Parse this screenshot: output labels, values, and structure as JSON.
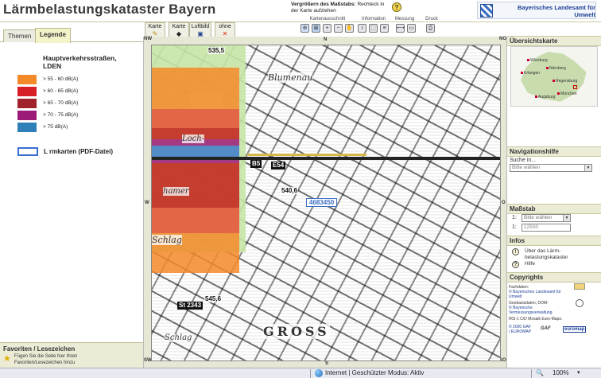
{
  "header": {
    "title": "Lärmbelastungskataster Bayern",
    "hint_bold": "Vergrößern des Maßstabs:",
    "hint_text": "Rechteck in der Karte aufziehen",
    "agency_line1": "Bayerisches Landesamt für",
    "agency_line2": "Umwelt"
  },
  "toolbar": {
    "tabs": [
      {
        "label": "Karte",
        "icon": "pencil-icon"
      },
      {
        "label": "Karte",
        "icon": "bucket-icon"
      },
      {
        "label": "Luftbild",
        "icon": "camera-icon"
      },
      {
        "label": "ohne",
        "icon": "close-icon"
      }
    ],
    "group_labels": [
      "Kartenausschnitt",
      "Information",
      "Messung",
      "Druck"
    ]
  },
  "left": {
    "tabs": [
      "Themen",
      "Legende"
    ],
    "active_tab": "Legende",
    "legend_title_1": "Hauptverkehrsstraßen,",
    "legend_title_2": "LDEN",
    "legend_items": [
      {
        "label": "> 55 - 60 dB(A)",
        "color": "#f4892a"
      },
      {
        "label": "> 60 - 65 dB(A)",
        "color": "#d61f26"
      },
      {
        "label": "> 65 - 70 dB(A)",
        "color": "#a0232c"
      },
      {
        "label": "> 70 - 75 dB(A)",
        "color": "#9c1a78"
      },
      {
        "label": "> 75 dB(A)",
        "color": "#2f7fb8"
      }
    ],
    "pdf_label": "L rmkarten (PDF-Datei)",
    "favorites_title": "Favoriten / Lesezeichen",
    "favorites_text": "Fügen Sie die Seite hier Ihren Favoriten/Lesezeichen hinzu"
  },
  "map": {
    "compass": {
      "nw": "NW",
      "n": "N",
      "no": "NO",
      "w": "W",
      "sw": "SW",
      "s": "S",
      "so": "SO",
      "o": "O",
      "w2": "W"
    },
    "labels": {
      "blumenau": "Blumenau",
      "loch": "Loch-",
      "hamer": "hamer",
      "schlag": "Schlag",
      "schlag2": "Schlag",
      "gross": "GROSS",
      "road_b5": "B5",
      "road_e54": "E54",
      "road_st": "St 2343",
      "elev1": "535,5",
      "elev2": "540,6",
      "elev3": "545,6",
      "coord": "4683450"
    }
  },
  "right": {
    "overview_title": "Übersichtskarte",
    "cities": [
      "Würzburg",
      "Nürnberg",
      "Erlangen",
      "Regensburg",
      "München",
      "Augsburg"
    ],
    "nav_title": "Navigationshilfe",
    "search_label": "Suche in...",
    "search_select": "Bitte wählen",
    "scale_title": "Maßstab",
    "scale_prefix": "1:",
    "scale_select": "Bitte wählen",
    "scale_value": "12500",
    "info_title": "Infos",
    "info_about": "Über das Lärm-belastungskataster",
    "info_help": "Hilfe",
    "copyright_title": "Copyrights",
    "copy_fachdaten": "Fachdaten:",
    "copy_fachdaten_src": "© Bayerisches Landesamt für Umwelt",
    "copy_geo": "Geobasisdaten, DOM:",
    "copy_geo_src": "© Bayerische Vermessungsverwaltung",
    "copy_irs": "IRS-1 C/D Mosaik Euro-Maps:",
    "copy_gaf": "© 2000 GAF",
    "copy_euromap": "/ EUROMAP",
    "logo_gaf": "GAF",
    "logo_euromap": "euromap"
  },
  "status": {
    "text": "Internet | Geschützter Modus: Aktiv",
    "zoom": "100%"
  }
}
